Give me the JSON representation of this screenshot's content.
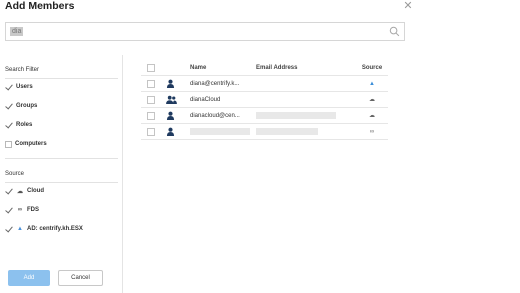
{
  "dialog": {
    "title": "Add Members",
    "close_icon": "close-icon"
  },
  "search": {
    "value": "dia",
    "icon": "search-icon"
  },
  "filters": {
    "heading": "Search Filter",
    "items": [
      {
        "label": "Users",
        "checked": true
      },
      {
        "label": "Groups",
        "checked": true
      },
      {
        "label": "Roles",
        "checked": true
      },
      {
        "label": "Computers",
        "checked": false
      }
    ]
  },
  "sources": {
    "heading": "Source",
    "items": [
      {
        "label": "Cloud",
        "icon": "cloud-icon",
        "glyph": "☁",
        "checked": true
      },
      {
        "label": "FDS",
        "icon": "link-icon",
        "glyph": "∞",
        "checked": true
      },
      {
        "label": "AD: centrify.kh.ESX",
        "icon": "triangle-icon",
        "glyph": "▲",
        "checked": true
      }
    ]
  },
  "table": {
    "columns": [
      "Name",
      "Email Address",
      "Source"
    ],
    "rows": [
      {
        "type_icon": "user-icon",
        "name": "diana@centrify.k...",
        "email": "",
        "source_icon": "triangle-icon",
        "source_glyph": "▲"
      },
      {
        "type_icon": "group-icon",
        "name": "dianaCloud",
        "email": "",
        "source_icon": "cloud-icon",
        "source_glyph": "☁"
      },
      {
        "type_icon": "user-icon",
        "name": "dianacloud@cen...",
        "email": "",
        "source_icon": "cloud-icon",
        "source_glyph": "☁"
      },
      {
        "type_icon": "user-icon",
        "name": "",
        "email": "",
        "source_icon": "link-icon",
        "source_glyph": "∞"
      }
    ]
  },
  "buttons": {
    "add": "Add",
    "cancel": "Cancel"
  },
  "colors": {
    "accent": "#8cc1ee",
    "user_icon": "#1f3a5f",
    "ad_source": "#3b8ed8"
  }
}
